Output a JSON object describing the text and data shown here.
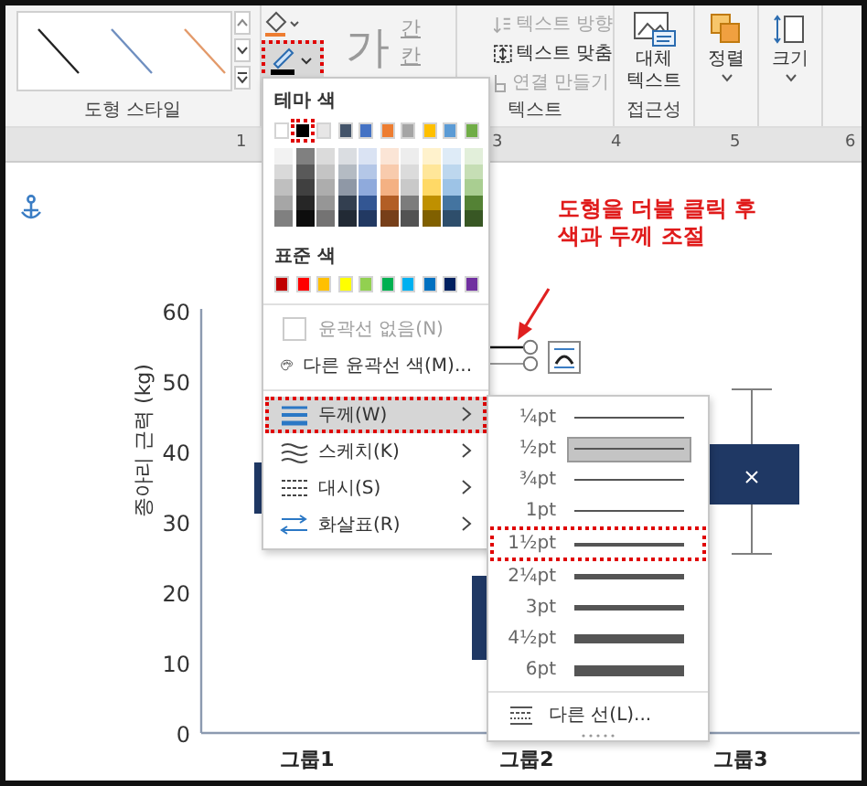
{
  "ribbon": {
    "shape_styles": {
      "label": "도형 스타일"
    },
    "tools": {
      "outline_active": true,
      "wordart_glyph": "가",
      "small_glyphs": [
        "간",
        "칸"
      ]
    },
    "text_group": {
      "items": [
        {
          "label": "텍스트 방향",
          "disabled": true,
          "kind": "direction"
        },
        {
          "label": "텍스트 맞춤",
          "disabled": false,
          "kind": "align"
        },
        {
          "label": "연결 만들기",
          "disabled": true,
          "kind": "link"
        }
      ],
      "label": "텍스트"
    },
    "alt_text": {
      "button": "대체 텍스트",
      "label": "접근성"
    },
    "arrange": {
      "label": "정렬"
    },
    "size": {
      "label": "크기"
    }
  },
  "ruler": [
    "1",
    "3",
    "4",
    "5",
    "6"
  ],
  "annotation": "도형을 더블 클릭 후\n색과 두께 조절",
  "chart": {
    "ylabel": "종아리 근력 (kg)",
    "yticks": [
      "60",
      "50",
      "40",
      "30",
      "20",
      "10",
      "0"
    ],
    "categories": [
      "그룹1",
      "그룹2",
      "그룹3"
    ]
  },
  "color_menu": {
    "theme_title": "테마 색",
    "theme_colors": [
      {
        "color": "#ffffff",
        "selected": false
      },
      {
        "color": "#000000",
        "selected": true
      },
      {
        "color": "#e7e6e6",
        "selected": false
      },
      {
        "color": "#44546a",
        "selected": false
      },
      {
        "color": "#4472c4",
        "selected": false
      },
      {
        "color": "#ed7d31",
        "selected": false
      },
      {
        "color": "#a5a5a5",
        "selected": false
      },
      {
        "color": "#ffc000",
        "selected": false
      },
      {
        "color": "#5b9bd5",
        "selected": false
      },
      {
        "color": "#70ad47",
        "selected": false
      }
    ],
    "standard_title": "표준 색",
    "standard_colors": [
      {
        "color": "#c00000"
      },
      {
        "color": "#ff0000"
      },
      {
        "color": "#ffc000"
      },
      {
        "color": "#ffff00"
      },
      {
        "color": "#92d050"
      },
      {
        "color": "#00b050"
      },
      {
        "color": "#00b0f0"
      },
      {
        "color": "#0070c0"
      },
      {
        "color": "#002060"
      },
      {
        "color": "#7030a0"
      }
    ],
    "items": [
      {
        "kind": "none",
        "label": "윤곽선 없음(N)",
        "disabled": true,
        "active": false
      },
      {
        "kind": "palette",
        "label": "다른 윤곽선 색(M)...",
        "disabled": false,
        "active": false
      },
      {
        "kind": "weight",
        "label": "두께(W)",
        "disabled": false,
        "active": true
      },
      {
        "kind": "sketch",
        "label": "스케치(K)",
        "disabled": false,
        "active": false
      },
      {
        "kind": "dash",
        "label": "대시(S)",
        "disabled": false,
        "active": false
      },
      {
        "kind": "arrows",
        "label": "화살표(R)",
        "disabled": false,
        "active": false
      }
    ]
  },
  "weight_menu": {
    "items": [
      {
        "label": "¼pt",
        "selected": false,
        "highlighted": false
      },
      {
        "label": "½pt",
        "selected": true,
        "highlighted": false
      },
      {
        "label": "¾pt",
        "selected": false,
        "highlighted": false
      },
      {
        "label": "1pt",
        "selected": false,
        "highlighted": false
      },
      {
        "label": "1½pt",
        "selected": false,
        "highlighted": true
      },
      {
        "label": "2¼pt",
        "selected": false,
        "highlighted": false
      },
      {
        "label": "3pt",
        "selected": false,
        "highlighted": false
      },
      {
        "label": "4½pt",
        "selected": false,
        "highlighted": false
      },
      {
        "label": "6pt",
        "selected": false,
        "highlighted": false
      }
    ],
    "more": "다른 선(L)..."
  }
}
